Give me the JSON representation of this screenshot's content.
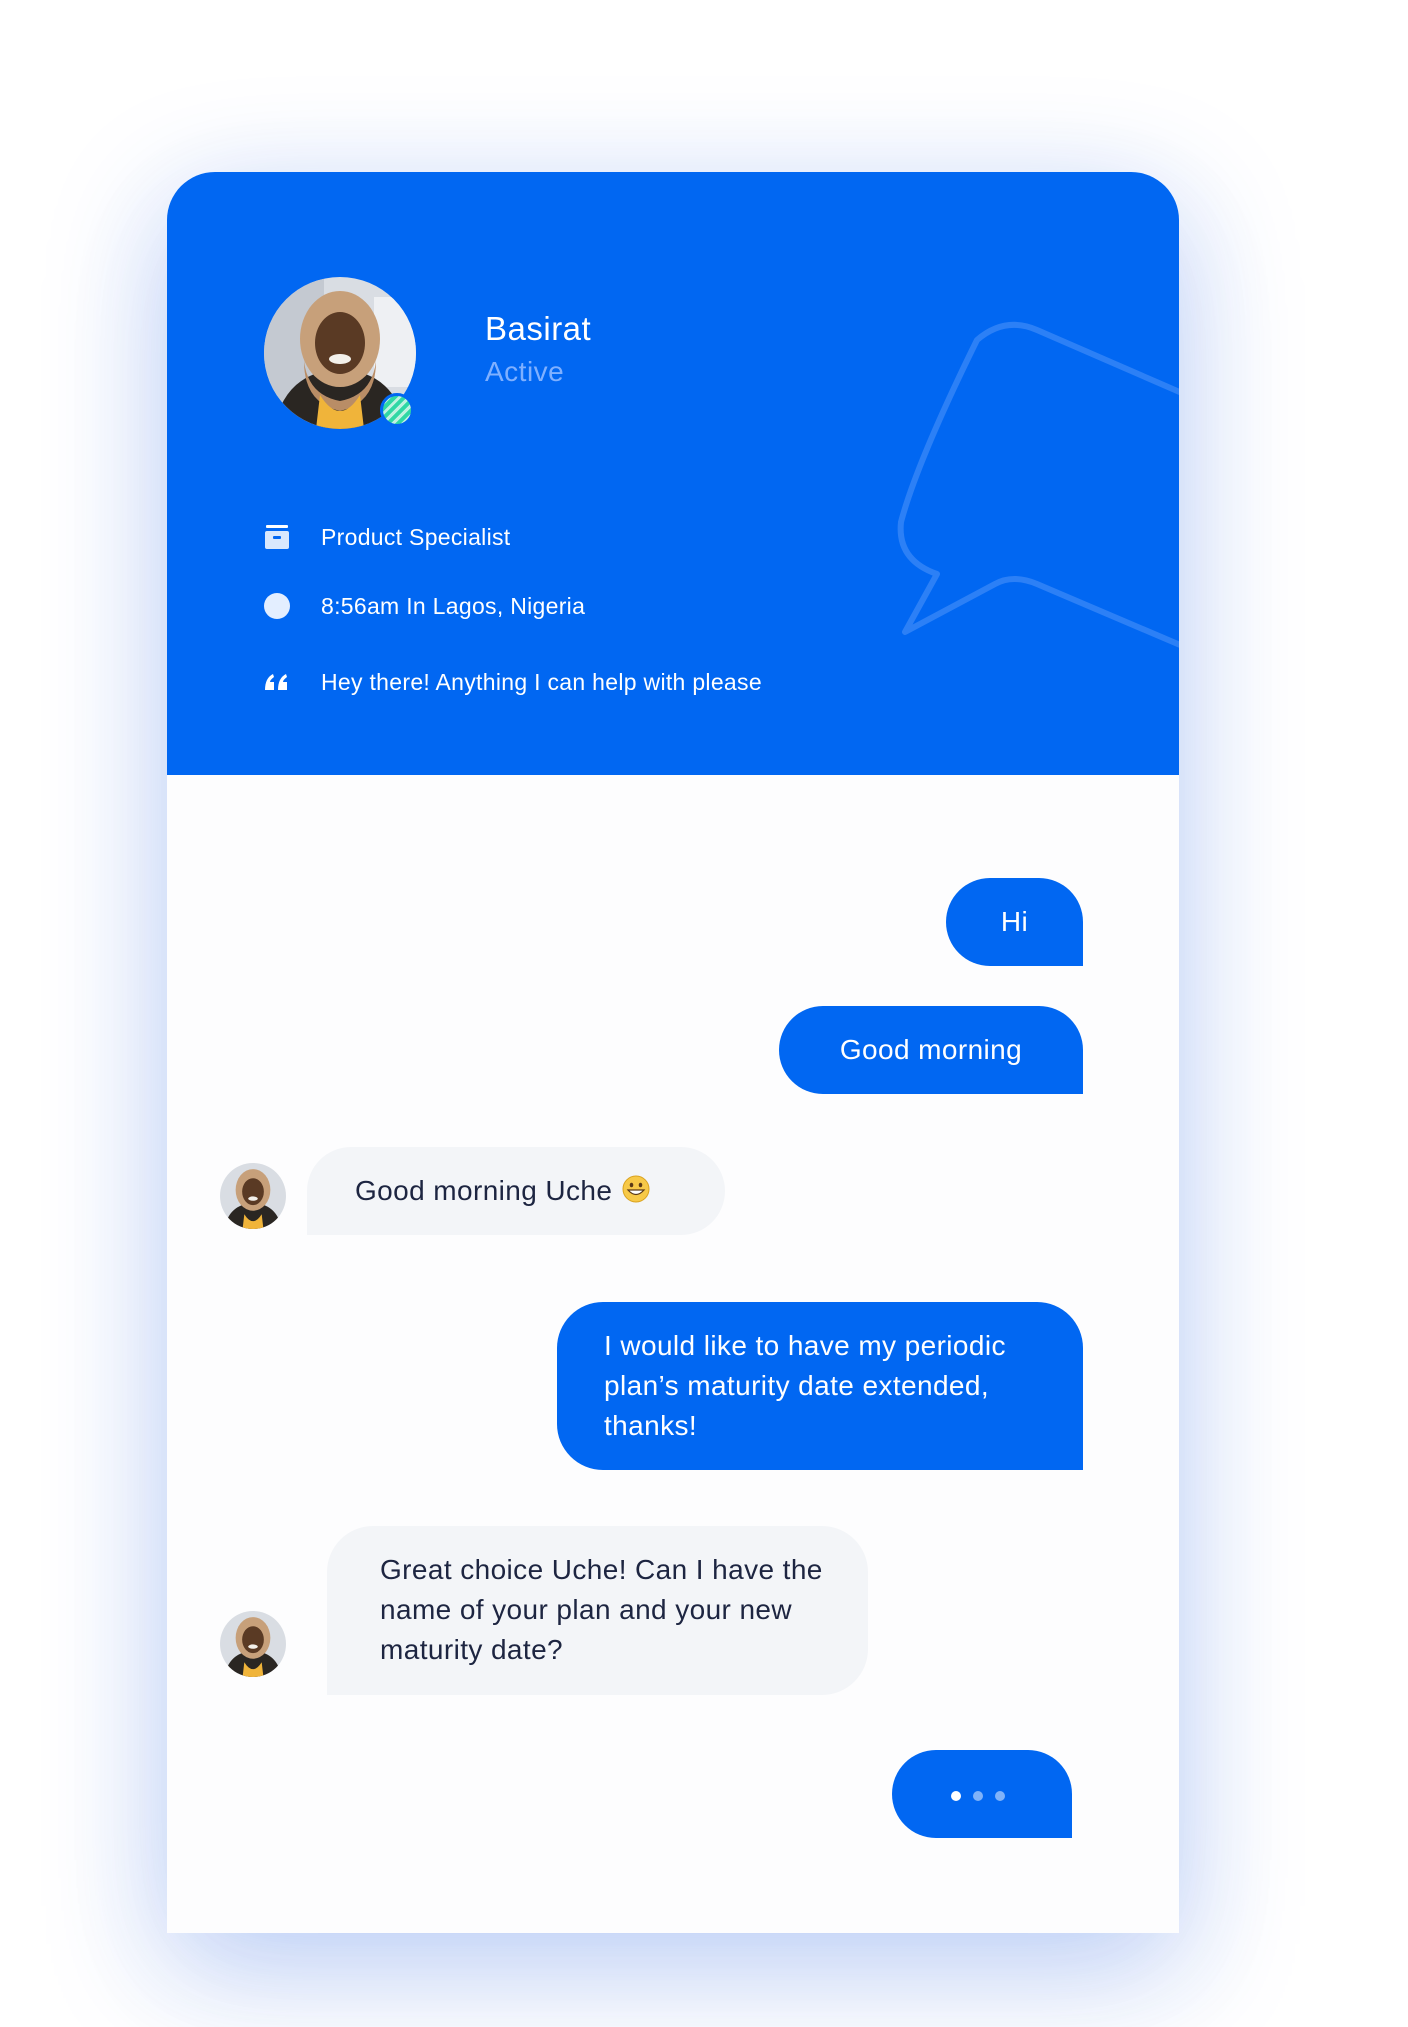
{
  "agent": {
    "name": "Basirat",
    "status": "Active",
    "role": "Product Specialist",
    "local_time": "8:56am In Lagos, Nigeria",
    "greeting": "Hey there! Anything I can help with please",
    "online_color": "#2fd8a5"
  },
  "icons": {
    "role": "briefcase-icon",
    "time": "clock-icon",
    "greeting": "quote-icon"
  },
  "messages": [
    {
      "from": "user",
      "text": "Hi"
    },
    {
      "from": "user",
      "text": "Good morning"
    },
    {
      "from": "agent",
      "text": "Good morning Uche",
      "emoji": "grinning-face"
    },
    {
      "from": "user",
      "lines": [
        "I would like to have my periodic",
        "plan’s maturity date extended,",
        "thanks!"
      ]
    },
    {
      "from": "agent",
      "lines": [
        "Great choice Uche! Can I have the",
        "name of your plan and your new",
        "maturity date?"
      ]
    }
  ],
  "typing_indicator": {
    "from": "user",
    "dots": 3
  },
  "colors": {
    "brand_blue": "#0167f2",
    "incoming_bubble": "#f3f5f8",
    "incoming_text": "#1d2541",
    "status_text": "#7fb0ff"
  }
}
